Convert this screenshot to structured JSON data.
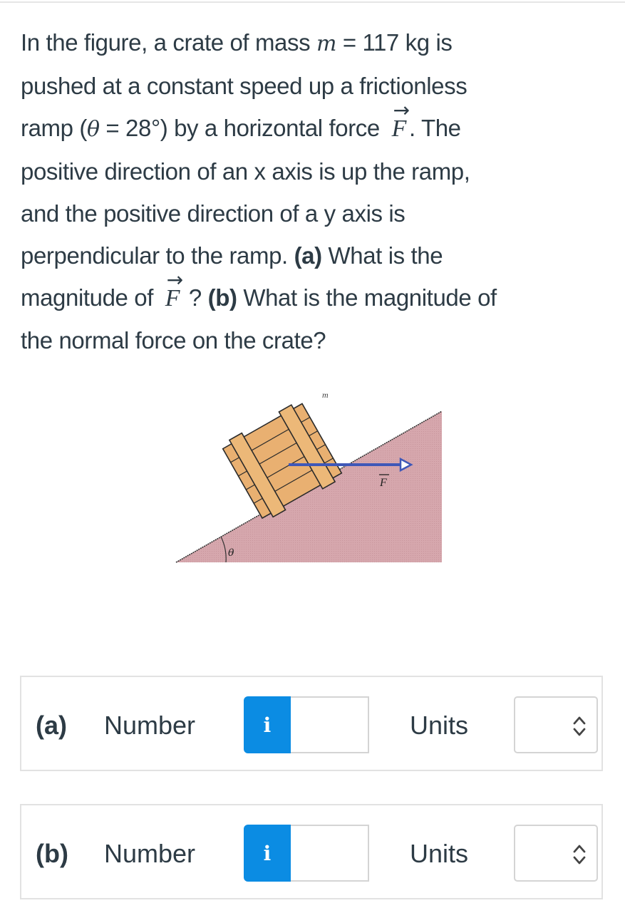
{
  "question": {
    "line1_pre": "In the figure, a crate of mass ",
    "mass_symbol": "m",
    "line1_post": " = 117 kg is",
    "line2": "pushed at a constant speed up a frictionless",
    "line3_pre": "ramp (",
    "theta_symbol": "θ",
    "line3_mid": " = 28°) by a horizontal force ",
    "force_symbol": "F",
    "vector_arrow": "→",
    "line3_post": ". The",
    "line4": "positive direction of an x axis is up the ramp,",
    "line5": "and the positive direction of a y axis is",
    "line6_pre": "perpendicular to the ramp. ",
    "part_a_tag": "(a)",
    "line6_post": " What is the",
    "line7_pre": "magnitude of ",
    "line7_mid": " ? ",
    "part_b_tag": "(b)",
    "line7_post": " What is the magnitude of",
    "line8": "the normal force on the crate?"
  },
  "figure": {
    "mass_label": "m",
    "force_label": "F",
    "angle_label": "θ",
    "colors": {
      "ramp": "#d6a7ad",
      "crate": "#e9b071",
      "arrow": "#3f58b8",
      "outline": "#2a2a2a"
    }
  },
  "answers": [
    {
      "part": "(a)",
      "number_label": "Number",
      "info_icon": "i",
      "number_value": "",
      "units_label": "Units",
      "units_selected": ""
    },
    {
      "part": "(b)",
      "number_label": "Number",
      "info_icon": "i",
      "number_value": "",
      "units_label": "Units",
      "units_selected": ""
    }
  ],
  "colors": {
    "accent": "#0b8ce3",
    "text": "#2d3b45",
    "border": "#e2e2e2"
  }
}
